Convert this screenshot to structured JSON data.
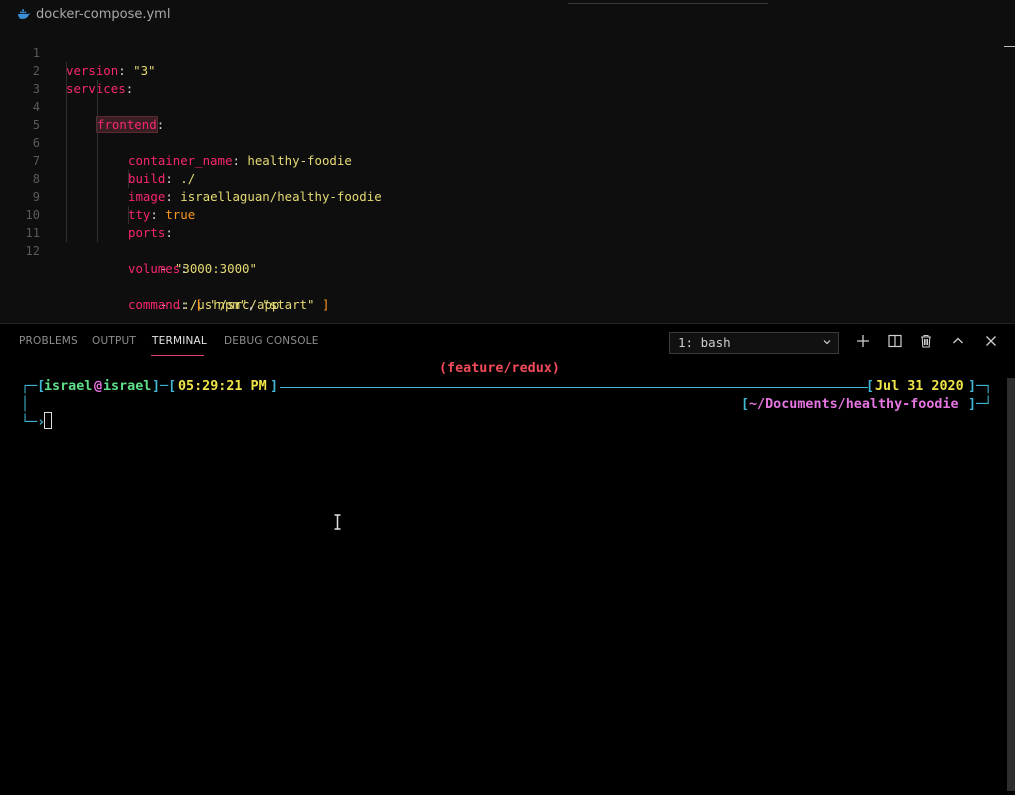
{
  "editor": {
    "file_name": "docker-compose.yml",
    "line_numbers": [
      "1",
      "2",
      "3",
      "4",
      "5",
      "6",
      "7",
      "8",
      "9",
      "10",
      "11",
      "12"
    ]
  },
  "code": {
    "l1": {
      "key": "version",
      "colon": ": ",
      "val": "\"3\""
    },
    "l2": {
      "key": "services",
      "colon": ":"
    },
    "l3": {
      "key": "frontend",
      "colon": ":"
    },
    "l4": {
      "key": "container_name",
      "colon": ": ",
      "val": "healthy-foodie"
    },
    "l5": {
      "key": "build",
      "colon": ": ",
      "val": "./"
    },
    "l6": {
      "key": "image",
      "colon": ": ",
      "val": "israellaguan/healthy-foodie"
    },
    "l7": {
      "key": "tty",
      "colon": ": ",
      "val": "true"
    },
    "l8": {
      "key": "ports",
      "colon": ":"
    },
    "l9": {
      "dash": "- ",
      "val": "\"3000:3000\""
    },
    "l10": {
      "key": "volumes",
      "colon": ":"
    },
    "l11": {
      "dash": "- ",
      "val": ".:/usr/src/app"
    },
    "l12": {
      "key": "command",
      "colon": ": ",
      "open": "[ ",
      "a": "\"npm\"",
      "comma": ", ",
      "b": "\"start\"",
      "close": " ]"
    }
  },
  "panel": {
    "tabs": [
      "PROBLEMS",
      "OUTPUT",
      "TERMINAL",
      "DEBUG CONSOLE"
    ],
    "active_tab": "TERMINAL",
    "terminal_select": "1: bash",
    "icons": [
      "plus-icon",
      "split-icon",
      "trash-icon",
      "chevron-up-icon",
      "close-icon"
    ]
  },
  "terminal": {
    "branch": "(feature/redux)",
    "user": "israel",
    "at": "@",
    "host": "israel",
    "time": "05:29:21 PM",
    "date": "Jul 31 2020",
    "path": "~/Documents/healthy-foodie"
  },
  "colors": {
    "accent": "#e0416f",
    "yaml_key": "#f92672",
    "yaml_string": "#e6db74",
    "prompt_cyan": "#3fb6d3",
    "prompt_green": "#5ee08a",
    "prompt_yellow": "#f0e548",
    "prompt_magenta": "#e575e0"
  }
}
